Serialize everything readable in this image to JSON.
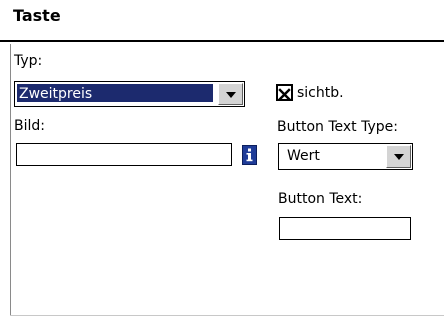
{
  "title": "Taste",
  "typ": {
    "label": "Typ:",
    "selected_value": "Zweitpreis"
  },
  "visible": {
    "checked": true,
    "label": "sichtb."
  },
  "image": {
    "label": "Bild:",
    "value": "",
    "info_icon": "info-icon"
  },
  "button_text_type": {
    "label": "Button Text Type:",
    "selected_value": "Wert"
  },
  "button_text": {
    "label": "Button Text:",
    "value": ""
  },
  "colors": {
    "selection": "#1c2a6e",
    "info_icon": "#1f3c98"
  }
}
